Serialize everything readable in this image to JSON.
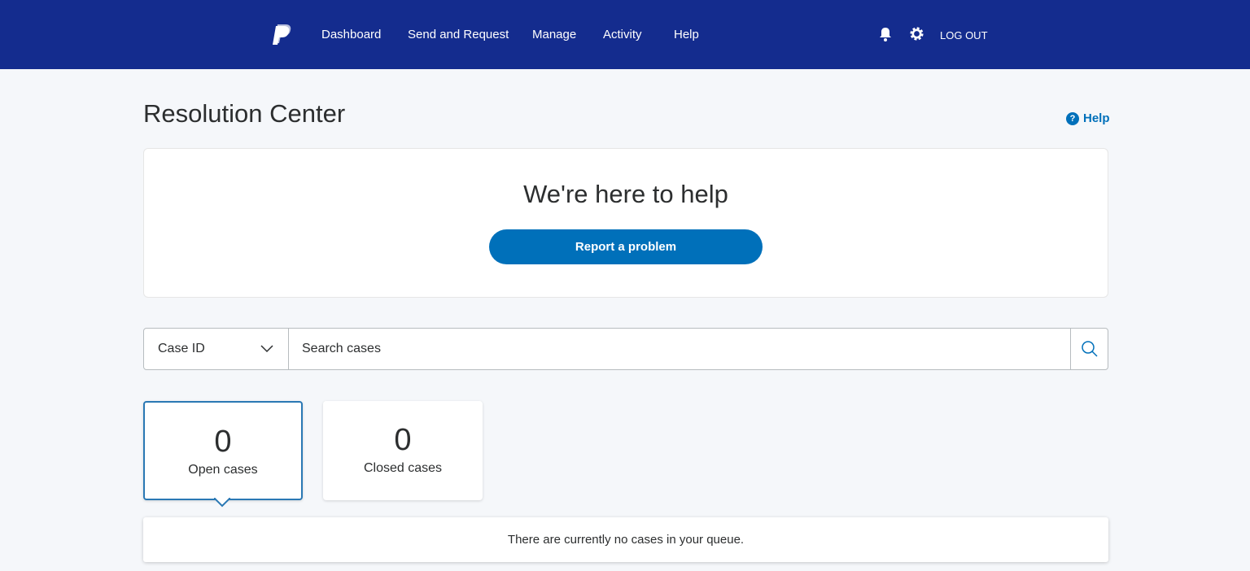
{
  "nav": {
    "items": [
      "Dashboard",
      "Send and Request",
      "Manage",
      "Activity",
      "Help"
    ],
    "logout": "LOG OUT"
  },
  "page": {
    "title": "Resolution Center",
    "help": "Help"
  },
  "hero": {
    "title": "We're here to help",
    "button": "Report a problem"
  },
  "search": {
    "type": "Case ID",
    "placeholder": "Search cases"
  },
  "tabs": [
    {
      "count": "0",
      "label": "Open cases"
    },
    {
      "count": "0",
      "label": "Closed cases"
    }
  ],
  "empty": "There are currently no cases in your queue.",
  "colors": {
    "nav": "#142c8e",
    "accent": "#0070ba"
  }
}
